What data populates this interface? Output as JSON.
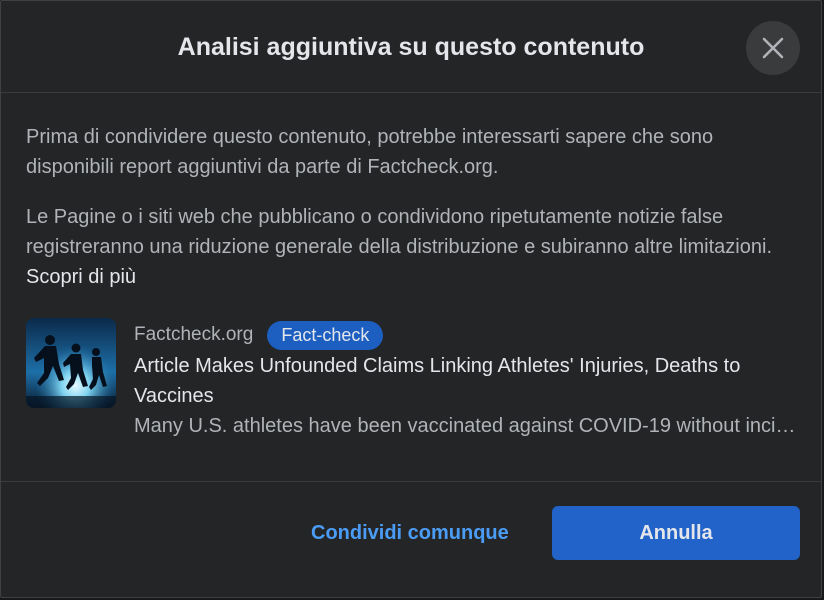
{
  "dialog": {
    "title": "Analisi aggiuntiva su questo contenuto",
    "close_icon": "close-icon"
  },
  "body": {
    "paragraph1": "Prima di condividere questo contenuto, potrebbe interessarti sapere che sono disponibili report aggiuntivi da parte di Factcheck.org.",
    "paragraph2": "Le Pagine o i siti web che pubblicano o condividono ripetutamente notizie false registreranno una riduzione generale della distribuzione e subiranno altre limitazioni.",
    "learn_more": "Scopri di più"
  },
  "article": {
    "source": "Factcheck.org",
    "badge": "Fact-check",
    "headline": "Article Makes Unfounded Claims Linking Athletes' Injuries, Deaths to Vaccines",
    "snippet": "Many U.S. athletes have been vaccinated against COVID-19 without incident",
    "thumbnail": "runners-silhouette-image"
  },
  "footer": {
    "share_anyway": "Condividi comunque",
    "cancel": "Annulla"
  },
  "colors": {
    "background": "#242526",
    "primary_button": "#2163c8",
    "link": "#4b9cf5",
    "badge": "#1d5fc1"
  }
}
